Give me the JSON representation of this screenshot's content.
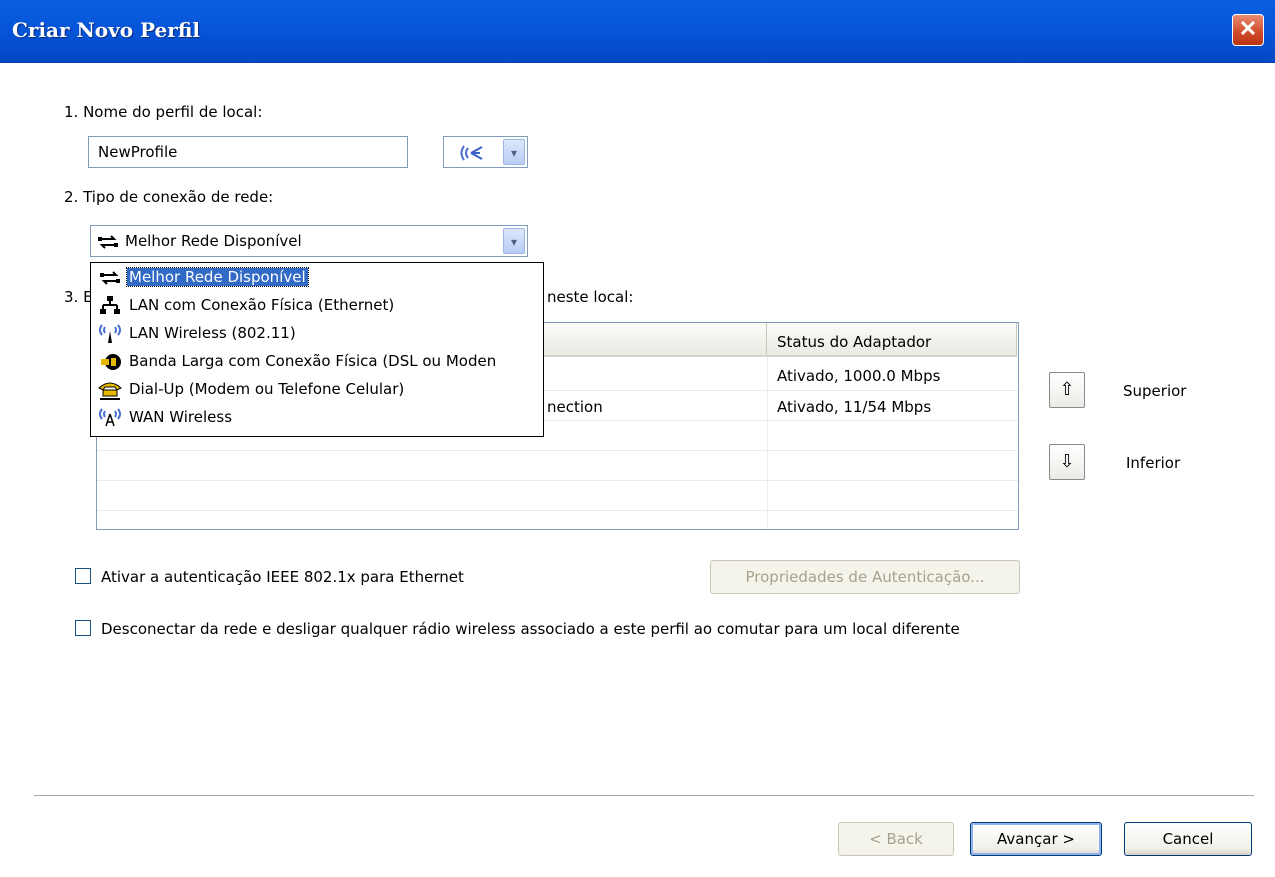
{
  "window": {
    "title": "Criar Novo Perfil",
    "close_glyph": "✕"
  },
  "step1": {
    "label": "1. Nome do perfil de local:",
    "name_value": "NewProfile",
    "icon_select_arrow": "▾"
  },
  "step2": {
    "label": "2. Tipo de conexão de rede:",
    "selected": "Melhor Rede Disponível"
  },
  "step3": {
    "label_prefix": "3. E",
    "label_suffix": "neste local:"
  },
  "dropdown": {
    "items": [
      {
        "label": "Melhor Rede Disponível",
        "icon": "best-network-icon",
        "selected": true
      },
      {
        "label": "LAN com Conexão Física (Ethernet)",
        "icon": "ethernet-icon",
        "selected": false
      },
      {
        "label": "LAN Wireless (802.11)",
        "icon": "wireless-lan-icon",
        "selected": false
      },
      {
        "label": "Banda Larga com Conexão Física (DSL ou Moden",
        "icon": "broadband-icon",
        "selected": false
      },
      {
        "label": "Dial-Up (Modem ou Telefone Celular)",
        "icon": "dialup-phone-icon",
        "selected": false
      },
      {
        "label": "WAN Wireless",
        "icon": "wireless-wan-icon",
        "selected": false
      }
    ]
  },
  "adapters_table": {
    "columns": [
      "",
      "Status do Adaptador"
    ],
    "rows": [
      {
        "name": "",
        "status": "Ativado, 1000.0 Mbps"
      },
      {
        "name": "nection",
        "status": "Ativado, 11/54 Mbps"
      }
    ]
  },
  "order_buttons": {
    "up_label": "Superior",
    "down_label": "Inferior",
    "up_glyph": "⇧",
    "down_glyph": "⇩"
  },
  "options": {
    "ieee_checkbox_label": "Ativar a autenticação IEEE 802.1x para Ethernet",
    "ieee_checked": false,
    "auth_properties_button": "Propriedades de Autenticação...",
    "disconnect_checkbox_label": "Desconectar da rede e desligar qualquer rádio wireless associado a este perfil ao comutar para um local diferente",
    "disconnect_checked": false
  },
  "footer": {
    "back_label": "< Back",
    "next_label": "Avançar >",
    "cancel_label": "Cancel"
  },
  "colors": {
    "titlebar": "#0553d7",
    "selection": "#316ac5",
    "close_button": "#cf4b2a"
  }
}
